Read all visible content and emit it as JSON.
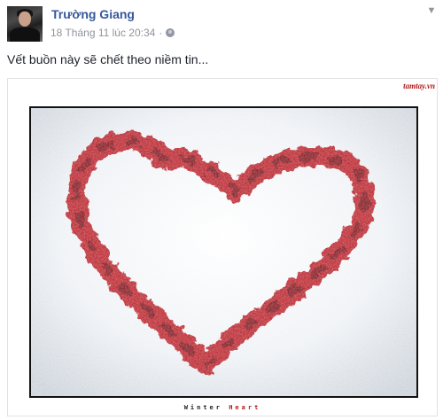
{
  "post": {
    "author": "Trường Giang",
    "timestamp": "18 Tháng 11 lúc 20:34",
    "separator": "·",
    "privacy_icon": "globe-icon",
    "status_text": "Vết buồn này sẽ chết theo niềm tin...",
    "options_icon": "chevron-down-icon"
  },
  "photo": {
    "watermark": "tamtay.vn",
    "caption_word1": "Winter",
    "caption_word2": "Heart",
    "caption_accent_color": "#b01818",
    "heart_color": "#b3121a"
  },
  "colors": {
    "author_link": "#365899",
    "meta_text": "#90949c",
    "body_text": "#1d2129"
  }
}
